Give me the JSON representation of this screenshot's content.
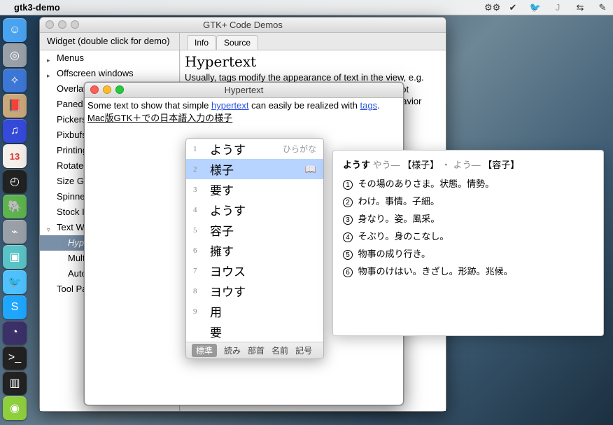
{
  "menubar": {
    "app_name": "gtk3-demo"
  },
  "menubar_icons": [
    "gears",
    "check",
    "bird",
    "J",
    "swap",
    "note"
  ],
  "dock": [
    {
      "name": "finder",
      "bg": "#4aa3ef",
      "glyph": "☺"
    },
    {
      "name": "launchpad",
      "bg": "#9aa0a8",
      "glyph": "◎"
    },
    {
      "name": "safari",
      "bg": "#3d77d6",
      "glyph": "✧"
    },
    {
      "name": "contacts",
      "bg": "#c9a87b",
      "glyph": "📕"
    },
    {
      "name": "itunes",
      "bg": "#354ad9",
      "glyph": "♫"
    },
    {
      "name": "calendar",
      "bg": "#f5f0ea",
      "glyph": "13"
    },
    {
      "name": "dashboard",
      "bg": "#222",
      "glyph": "◴"
    },
    {
      "name": "evernote",
      "bg": "#5eb34e",
      "glyph": "🐘"
    },
    {
      "name": "disk",
      "bg": "#9aa0a8",
      "glyph": "⌁"
    },
    {
      "name": "image",
      "bg": "#5ac3c7",
      "glyph": "▣"
    },
    {
      "name": "twitter",
      "bg": "#4ec2ff",
      "glyph": "🐦"
    },
    {
      "name": "skype",
      "bg": "#1ea7ff",
      "glyph": "S"
    },
    {
      "name": "eclipse",
      "bg": "#3b3168",
      "glyph": "◔"
    },
    {
      "name": "terminal",
      "bg": "#222",
      "glyph": ">_"
    },
    {
      "name": "equalizer",
      "bg": "#222",
      "glyph": "▥"
    },
    {
      "name": "lime",
      "bg": "#8ecf3d",
      "glyph": "◉"
    }
  ],
  "main_window": {
    "title": "GTK+ Code Demos",
    "widget_label": "Widget (double click for demo)",
    "tabs": [
      "Info",
      "Source"
    ],
    "sidebar": [
      {
        "label": "Menus",
        "arrow": "▸"
      },
      {
        "label": "Offscreen windows",
        "arrow": "▸"
      },
      {
        "label": "Overlay",
        "sub": false
      },
      {
        "label": "Paned Widgets",
        "sub": false
      },
      {
        "label": "Pickers",
        "sub": false
      },
      {
        "label": "Pixbufs",
        "sub": false
      },
      {
        "label": "Printing",
        "sub": false
      },
      {
        "label": "Rotated Text",
        "sub": false
      },
      {
        "label": "Size Groups",
        "sub": false
      },
      {
        "label": "Spinner",
        "sub": false
      },
      {
        "label": "Stock Item and Icon Browser",
        "sub": false
      },
      {
        "label": "Text Widget",
        "arrow": "▿",
        "children": [
          {
            "label": "Hypertext",
            "selected": true
          },
          {
            "label": "Multiple Views"
          },
          {
            "label": "Automatic Scrolling"
          }
        ]
      },
      {
        "label": "Tool Palette",
        "sub": false
      }
    ],
    "content_title": "Hypertext",
    "content_body": "Usually, tags modify the appearance of text in the view, e.g. making it bold or colored or underlined. But tags are not restricted to appearance. They can also affect the behavior"
  },
  "hyper_window": {
    "title": "Hypertext",
    "line1a": "Some text to show that simple ",
    "line1b_link": "hypertext",
    "line1c": " can easily be realized with ",
    "line1d_link": "tags",
    "line1e": ".",
    "line2": "Mac版GTK＋での日本語入力の様子"
  },
  "ime": {
    "candidates": [
      {
        "n": "1",
        "word": "ようす",
        "hint": "ひらがな"
      },
      {
        "n": "2",
        "word": "様子",
        "selected": true,
        "book": "📖"
      },
      {
        "n": "3",
        "word": "要す"
      },
      {
        "n": "4",
        "word": "ようす"
      },
      {
        "n": "5",
        "word": "容子"
      },
      {
        "n": "6",
        "word": "擁す"
      },
      {
        "n": "7",
        "word": "ヨウス"
      },
      {
        "n": "8",
        "word": "ヨウす"
      },
      {
        "n": "9",
        "word": "用"
      },
      {
        "n": "",
        "word": "要"
      }
    ],
    "footer": [
      "標準",
      "読み",
      "部首",
      "名前",
      "記号"
    ]
  },
  "dict": {
    "head_bold": "ようす",
    "head_grey": "やう—",
    "head_bracket1": "【様子】",
    "head_dot": "・",
    "head_alt": "よう—",
    "head_bracket2": "【容子】",
    "defs": [
      "その場のありさま。状態。情勢。",
      "わけ。事情。子細。",
      "身なり。姿。風采。",
      "そぶり。身のこなし。",
      "物事の成り行き。",
      "物事のけはい。きざし。形跡。兆候。"
    ]
  }
}
